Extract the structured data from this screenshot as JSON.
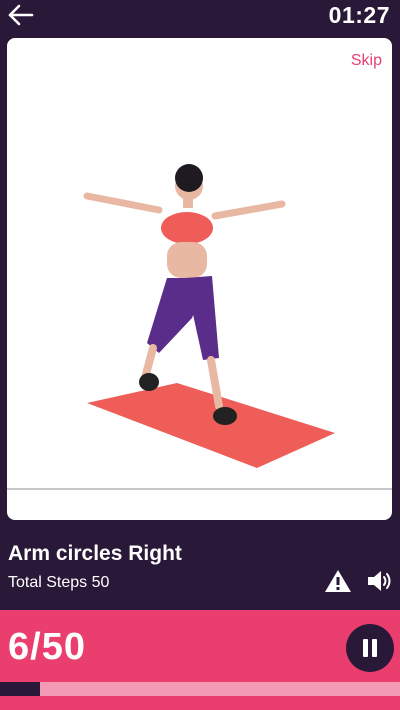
{
  "header": {
    "back_icon": "arrow-left-icon",
    "timer": "01:27"
  },
  "exercise": {
    "skip_label": "Skip",
    "name": "Arm circles Right",
    "total_steps_text": "Total Steps 50",
    "warning_icon": "warning-icon",
    "sound_icon": "speaker-icon"
  },
  "progress": {
    "step_text": "6/50",
    "current": 6,
    "total": 50,
    "fraction": 0.1,
    "pause_icon": "pause-icon"
  },
  "colors": {
    "background": "#2a1838",
    "accent": "#ea3f6e",
    "track": "#f39ab5"
  }
}
